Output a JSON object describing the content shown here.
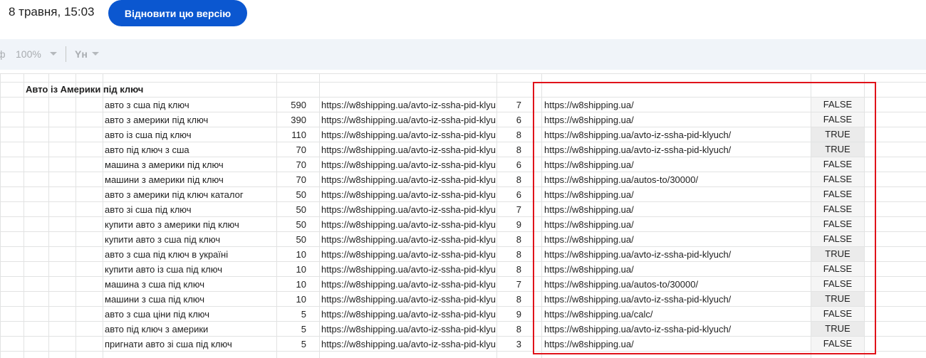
{
  "header": {
    "version_date": "8 травня, 15:03",
    "restore_button": "Відновити цю версію"
  },
  "toolbar": {
    "zoom": "100%",
    "text_format_icon": "Yн"
  },
  "sheet": {
    "group_title": "Авто із Америки під ключ",
    "rows": [
      {
        "keyword": "авто з сша під ключ",
        "volume": "590",
        "url": "https://w8shipping.ua/avto-iz-ssha-pid-klyuch/",
        "position": "7",
        "ranking_url": "https://w8shipping.ua/",
        "match": "FALSE"
      },
      {
        "keyword": "авто з америки під ключ",
        "volume": "390",
        "url": "https://w8shipping.ua/avto-iz-ssha-pid-klyuch/",
        "position": "6",
        "ranking_url": "https://w8shipping.ua/",
        "match": "FALSE"
      },
      {
        "keyword": "авто із сша під ключ",
        "volume": "110",
        "url": "https://w8shipping.ua/avto-iz-ssha-pid-klyuch/",
        "position": "8",
        "ranking_url": "https://w8shipping.ua/avto-iz-ssha-pid-klyuch/",
        "match": "TRUE"
      },
      {
        "keyword": "авто під ключ з сша",
        "volume": "70",
        "url": "https://w8shipping.ua/avto-iz-ssha-pid-klyuch/",
        "position": "8",
        "ranking_url": "https://w8shipping.ua/avto-iz-ssha-pid-klyuch/",
        "match": "TRUE"
      },
      {
        "keyword": "машина з америки під ключ",
        "volume": "70",
        "url": "https://w8shipping.ua/avto-iz-ssha-pid-klyuch/",
        "position": "6",
        "ranking_url": "https://w8shipping.ua/",
        "match": "FALSE"
      },
      {
        "keyword": "машини з америки під ключ",
        "volume": "70",
        "url": "https://w8shipping.ua/avto-iz-ssha-pid-klyuch/",
        "position": "8",
        "ranking_url": "https://w8shipping.ua/autos-to/30000/",
        "match": "FALSE"
      },
      {
        "keyword": "авто з америки під ключ каталог",
        "volume": "50",
        "url": "https://w8shipping.ua/avto-iz-ssha-pid-klyuch/",
        "position": "6",
        "ranking_url": "https://w8shipping.ua/",
        "match": "FALSE"
      },
      {
        "keyword": "авто зі сша під ключ",
        "volume": "50",
        "url": "https://w8shipping.ua/avto-iz-ssha-pid-klyuch/",
        "position": "7",
        "ranking_url": "https://w8shipping.ua/",
        "match": "FALSE"
      },
      {
        "keyword": "купити авто з америки під ключ",
        "volume": "50",
        "url": "https://w8shipping.ua/avto-iz-ssha-pid-klyuch/",
        "position": "9",
        "ranking_url": "https://w8shipping.ua/",
        "match": "FALSE"
      },
      {
        "keyword": "купити авто з сша під ключ",
        "volume": "50",
        "url": "https://w8shipping.ua/avto-iz-ssha-pid-klyuch/",
        "position": "8",
        "ranking_url": "https://w8shipping.ua/",
        "match": "FALSE"
      },
      {
        "keyword": "авто з сша під ключ в україні",
        "volume": "10",
        "url": "https://w8shipping.ua/avto-iz-ssha-pid-klyuch/",
        "position": "8",
        "ranking_url": "https://w8shipping.ua/avto-iz-ssha-pid-klyuch/",
        "match": "TRUE"
      },
      {
        "keyword": "купити авто із сша під ключ",
        "volume": "10",
        "url": "https://w8shipping.ua/avto-iz-ssha-pid-klyuch/",
        "position": "8",
        "ranking_url": "https://w8shipping.ua/",
        "match": "FALSE"
      },
      {
        "keyword": "машина з сша під ключ",
        "volume": "10",
        "url": "https://w8shipping.ua/avto-iz-ssha-pid-klyuch/",
        "position": "7",
        "ranking_url": "https://w8shipping.ua/autos-to/30000/",
        "match": "FALSE"
      },
      {
        "keyword": "машини з сша під ключ",
        "volume": "10",
        "url": "https://w8shipping.ua/avto-iz-ssha-pid-klyuch/",
        "position": "8",
        "ranking_url": "https://w8shipping.ua/avto-iz-ssha-pid-klyuch/",
        "match": "TRUE"
      },
      {
        "keyword": "авто з сша ціни під ключ",
        "volume": "5",
        "url": "https://w8shipping.ua/avto-iz-ssha-pid-klyuch/",
        "position": "9",
        "ranking_url": "https://w8shipping.ua/calc/",
        "match": "FALSE"
      },
      {
        "keyword": "авто під ключ з америки",
        "volume": "5",
        "url": "https://w8shipping.ua/avto-iz-ssha-pid-klyuch/",
        "position": "8",
        "ranking_url": "https://w8shipping.ua/avto-iz-ssha-pid-klyuch/",
        "match": "TRUE"
      },
      {
        "keyword": "пригнати авто зі сша під ключ",
        "volume": "5",
        "url": "https://w8shipping.ua/avto-iz-ssha-pid-klyuch/",
        "position": "3",
        "ranking_url": "https://w8shipping.ua/",
        "match": "FALSE"
      }
    ]
  },
  "colors": {
    "accent": "#0b57d0",
    "highlight_border": "#e0121a",
    "true_cell_bg": "#ebebeb",
    "false_cell_bg": "#f5f5f5"
  }
}
